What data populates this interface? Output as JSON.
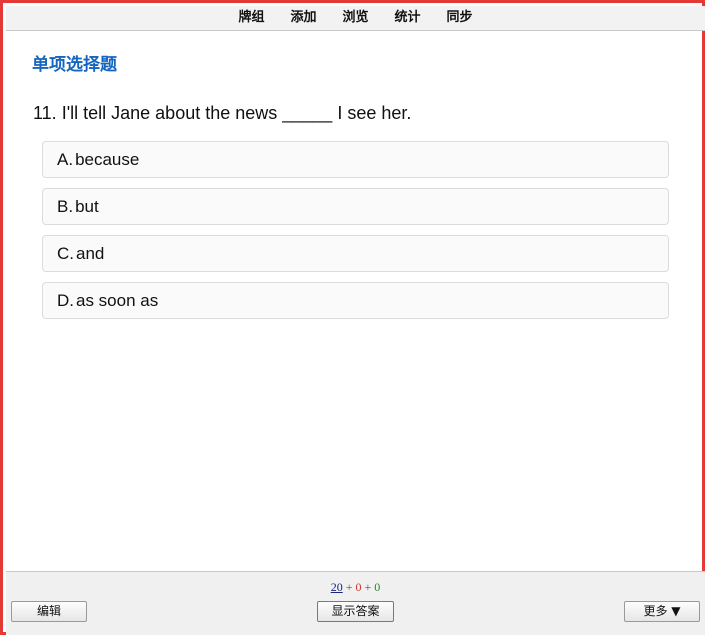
{
  "nav": {
    "items": [
      {
        "label": "牌组"
      },
      {
        "label": "添加"
      },
      {
        "label": "浏览"
      },
      {
        "label": "统计"
      },
      {
        "label": "同步"
      }
    ]
  },
  "card": {
    "section_title": "单项选择题",
    "question": "11. I'll tell Jane about the news _____ I see her.",
    "options": [
      {
        "letter": "A.",
        "text": "because"
      },
      {
        "letter": "B.",
        "text": "but"
      },
      {
        "letter": "C.",
        "text": "and"
      },
      {
        "letter": "D.",
        "text": "as soon as"
      }
    ]
  },
  "bottom": {
    "counts": {
      "new": "20",
      "sep1": " + ",
      "learning": "0",
      "sep2": " + ",
      "review": "0"
    },
    "edit_label": "编辑",
    "show_answer_label": "显示答案",
    "more_label": "更多 ▼"
  },
  "colors": {
    "border": "#e53935",
    "title": "#1565c0",
    "count_new": "#1a237e",
    "count_learning": "#d32f2f",
    "count_review": "#2e7d32"
  }
}
